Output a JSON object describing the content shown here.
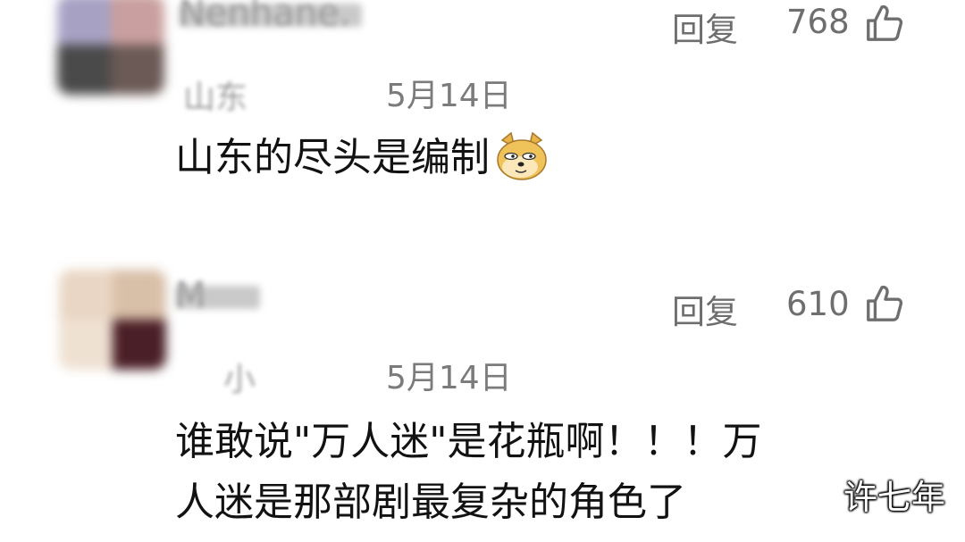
{
  "comments": [
    {
      "username": "Nenhane.",
      "location_blur": "山东",
      "date": "5月14日",
      "reply_label": "回复",
      "like_count": "768",
      "text": "山东的尽头是编制",
      "emoji": "doge-emoji"
    },
    {
      "username": "M",
      "location_blur": "小",
      "date": "5月14日",
      "reply_label": "回复",
      "like_count": "610",
      "text_line1": "谁敢说\"万人迷\"是花瓶啊！！！万",
      "text_line2": "人迷是那部剧最复杂的角色了"
    }
  ],
  "watermark": "许七年",
  "icons": {
    "like": "thumbs-up-icon"
  },
  "colors": {
    "meta": "#7b7b7b",
    "text": "#121212",
    "background": "#ffffff"
  }
}
